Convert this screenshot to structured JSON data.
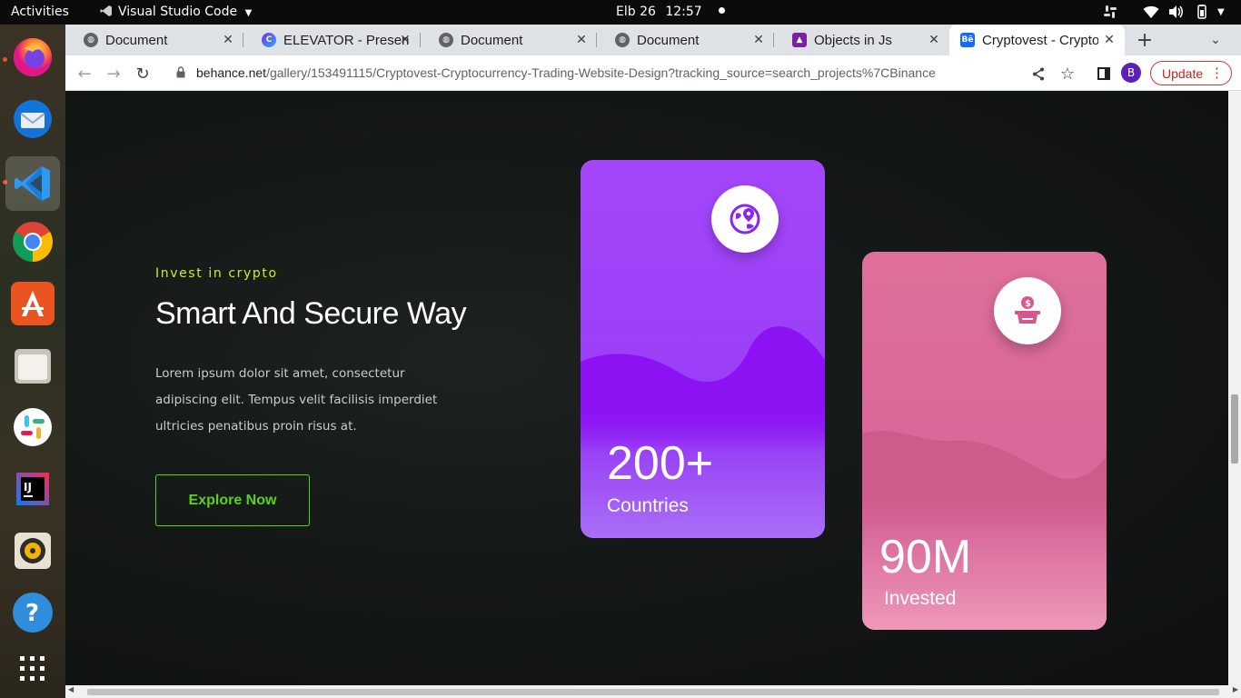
{
  "system": {
    "activities": "Activities",
    "app_name": "Visual Studio Code",
    "date": "Elb 26",
    "time": "12:57"
  },
  "tabs": [
    {
      "title": "Document"
    },
    {
      "title": "ELEVATOR - Presen"
    },
    {
      "title": "Document"
    },
    {
      "title": "Document"
    },
    {
      "title": "Objects in Js"
    },
    {
      "title": "Cryptovest - Crypto"
    }
  ],
  "address": {
    "host": "behance.net",
    "path": "/gallery/153491115/Cryptovest-Cryptocurrency-Trading-Website-Design?tracking_source=search_projects%7CBinance"
  },
  "profile_initial": "B",
  "update_label": "Update",
  "hero": {
    "eyebrow": "Invest in crypto",
    "title": "Smart And Secure Way",
    "description": "Lorem ipsum dolor sit amet, consectetur adipiscing elit. Tempus velit facilisis imperdiet ultricies penatibus proin risus at.",
    "cta": "Explore Now"
  },
  "cards": [
    {
      "value": "200+",
      "label": "Countries",
      "icon": "globe-pin-icon",
      "color": "#9b3cf7"
    },
    {
      "value": "90M",
      "label": "Invested",
      "icon": "money-box-icon",
      "color": "#e0709a"
    }
  ],
  "colors": {
    "eyebrow": "#c5f31c",
    "cta": "#5ad11e",
    "purple_card": "#9b3cf7",
    "pink_card": "#e0709a"
  }
}
